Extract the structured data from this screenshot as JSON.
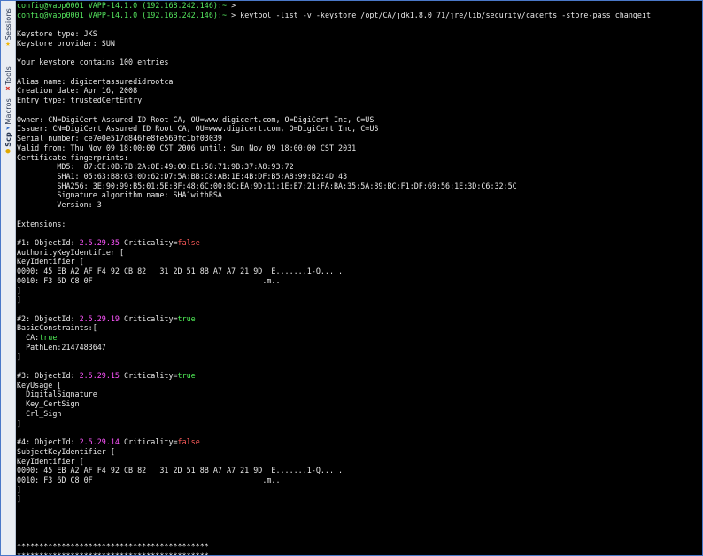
{
  "sidebar": {
    "tabs": [
      {
        "label": "Sessions",
        "icon": "star-icon",
        "color": "#f2b705"
      },
      {
        "label": "Tools",
        "icon": "tools-icon",
        "color": "#d9372b"
      },
      {
        "label": "Macros",
        "icon": "macros-icon",
        "color": "#3a72c9"
      },
      {
        "label": "Scp",
        "icon": "scp-icon",
        "color": "#e0a800"
      }
    ]
  },
  "terminal": {
    "prompt1": {
      "user": "config@vapp0001",
      "host": "VAPP-14.1.0",
      "ip": "(192.168.242.146):~",
      "sym": ">"
    },
    "prompt2": {
      "user": "config@vapp0001",
      "host": "VAPP-14.1.0",
      "ip": "(192.168.242.146):~",
      "sym": ">",
      "cmd": " keytool -list -v -keystore /opt/CA/jdk1.8.0_71/jre/lib/security/cacerts -store-pass changeit"
    },
    "l_keystore_type": "Keystore type: JKS",
    "l_keystore_provider": "Keystore provider: SUN",
    "l_entries": "Your keystore contains 100 entries",
    "l_alias": "Alias name: digicertassuredidrootca",
    "l_creation": "Creation date: Apr 16, 2008",
    "l_entry_type": "Entry type: trustedCertEntry",
    "l_owner": "Owner: CN=DigiCert Assured ID Root CA, OU=www.digicert.com, O=DigiCert Inc, C=US",
    "l_issuer": "Issuer: CN=DigiCert Assured ID Root CA, OU=www.digicert.com, O=DigiCert Inc, C=US",
    "l_serial": "Serial number: ce7e0e517d846fe8fe560fc1bf03039",
    "l_valid": "Valid from: Thu Nov 09 18:00:00 CST 2006 until: Sun Nov 09 18:00:00 CST 2031",
    "l_fingerprints": "Certificate fingerprints:",
    "l_md5": "         MD5:  87:CE:0B:7B:2A:0E:49:00:E1:58:71:9B:37:A8:93:72",
    "l_sha1": "         SHA1: 05:63:B8:63:0D:62:D7:5A:BB:C8:AB:1E:4B:DF:B5:A8:99:B2:4D:43",
    "l_sha256": "         SHA256: 3E:90:99:B5:01:5E:8F:48:6C:00:BC:EA:9D:11:1E:E7:21:FA:BA:35:5A:89:BC:F1:DF:69:56:1E:3D:C6:32:5C",
    "l_sigalg": "         Signature algorithm name: SHA1withRSA",
    "l_version": "         Version: 3",
    "l_extensions": "Extensions:",
    "ext1": {
      "prefix": "#1: ObjectId: ",
      "oid": "2.5.29.35",
      "crit_label": " Criticality=",
      "crit": "false"
    },
    "ext1_lines": [
      "AuthorityKeyIdentifier [",
      "KeyIdentifier [",
      "0000: 45 EB A2 AF F4 92 CB 82   31 2D 51 8B A7 A7 21 9D  E.......1-Q...!.",
      "0010: F3 6D C8 0F                                      .m..",
      "]",
      "]"
    ],
    "ext2": {
      "prefix": "#2: ObjectId: ",
      "oid": "2.5.29.19",
      "crit_label": " Criticality=",
      "crit": "true"
    },
    "ext2_l1": "BasicConstraints:[",
    "ext2_ca_label": "  CA:",
    "ext2_ca_val": "true",
    "ext2_l3": "  PathLen:2147483647",
    "ext2_l4": "]",
    "ext3": {
      "prefix": "#3: ObjectId: ",
      "oid": "2.5.29.15",
      "crit_label": " Criticality=",
      "crit": "true"
    },
    "ext3_lines": [
      "KeyUsage [",
      "  DigitalSignature",
      "  Key_CertSign",
      "  Crl_Sign",
      "]"
    ],
    "ext4": {
      "prefix": "#4: ObjectId: ",
      "oid": "2.5.29.14",
      "crit_label": " Criticality=",
      "crit": "false"
    },
    "ext4_lines": [
      "SubjectKeyIdentifier [",
      "KeyIdentifier [",
      "0000: 45 EB A2 AF F4 92 CB 82   31 2D 51 8B A7 A7 21 9D  E.......1-Q...!.",
      "0010: F3 6D C8 0F                                      .m..",
      "]",
      "]"
    ],
    "stars1": "*******************************************",
    "stars2": "*******************************************"
  }
}
